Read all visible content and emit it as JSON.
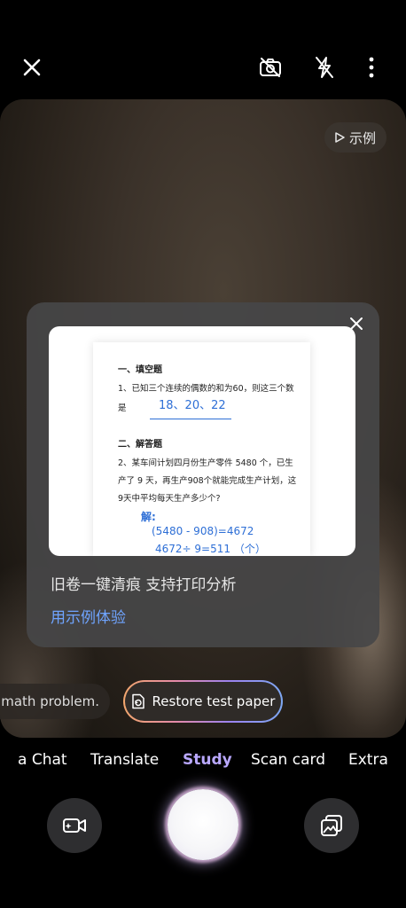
{
  "example_button": {
    "label": "示例"
  },
  "card": {
    "title": "旧卷一键清痕 支持打印分析",
    "link": "用示例体验",
    "preview": {
      "section1": "一、填空题",
      "q1_line1": "1、已知三个连续的偶数的和为60，则这三个数",
      "q1_line2": "是",
      "q1_answer": "18、20、22",
      "section2": "二、解答题",
      "q2_line1": "2、某车间计划四月份生产零件 5480 个，已生",
      "q2_line2": "产了 9 天，再生产908个就能完成生产计划，这",
      "q2_line3": "9天中平均每天生产多少个?",
      "solution_label": "解:",
      "solution_1": "(5480 - 908)=4672",
      "solution_2": "4672÷ 9=511 （个）"
    }
  },
  "chips": {
    "previous": "math problem.",
    "active": "Restore test paper"
  },
  "modes": [
    "a Chat",
    "Translate",
    "Study",
    "Scan card",
    "Extra"
  ],
  "active_mode": "Study",
  "colors": {
    "accent": "#b9a8ff",
    "link": "#6fa4ff",
    "answer_blue": "#2e6fd6"
  }
}
